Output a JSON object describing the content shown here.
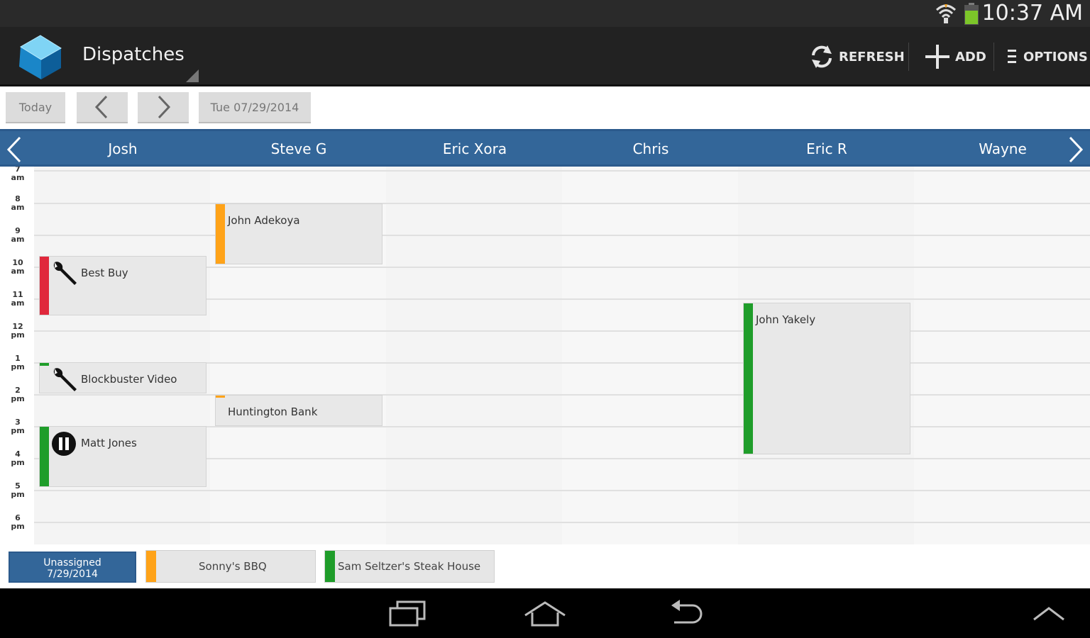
{
  "status_bar": {
    "time": "10:37 AM"
  },
  "app": {
    "title": "Dispatches"
  },
  "actions": {
    "refresh": "REFRESH",
    "add": "ADD",
    "options": "OPTIONS"
  },
  "toolbar": {
    "today": "Today",
    "date": "Tue 07/29/2014"
  },
  "technicians": [
    "Josh",
    "Steve G",
    "Eric Xora",
    "Chris",
    "Eric R",
    "Wayne"
  ],
  "time_slots": [
    {
      "h": "7",
      "p": "am"
    },
    {
      "h": "8",
      "p": "am"
    },
    {
      "h": "9",
      "p": "am"
    },
    {
      "h": "10",
      "p": "am"
    },
    {
      "h": "11",
      "p": "am"
    },
    {
      "h": "12",
      "p": "pm"
    },
    {
      "h": "1",
      "p": "pm"
    },
    {
      "h": "2",
      "p": "pm"
    },
    {
      "h": "3",
      "p": "pm"
    },
    {
      "h": "4",
      "p": "pm"
    },
    {
      "h": "5",
      "p": "pm"
    },
    {
      "h": "6",
      "p": "pm"
    }
  ],
  "appointments": [
    {
      "name": "Best Buy",
      "tech": "Josh",
      "color": "#e0283c",
      "icon": "wrench-icon"
    },
    {
      "name": "Blockbuster Video",
      "tech": "Josh",
      "color": "#1f9d2a",
      "icon": "wrench-icon"
    },
    {
      "name": "Matt Jones",
      "tech": "Josh",
      "color": "#1f9d2a",
      "icon": "pause-icon"
    },
    {
      "name": "John Adekoya",
      "tech": "Steve G",
      "color": "#ffa319",
      "icon": ""
    },
    {
      "name": "Huntington Bank",
      "tech": "Steve G",
      "color": "#ffa319",
      "icon": ""
    },
    {
      "name": "John Yakely",
      "tech": "Eric R",
      "color": "#1f9d2a",
      "icon": ""
    }
  ],
  "legend": {
    "unassigned_line1": "Unassigned",
    "unassigned_line2": "7/29/2014",
    "items": [
      {
        "name": "Sonny's BBQ",
        "color": "#ffa319"
      },
      {
        "name": "Sam Seltzer's Steak House",
        "color": "#1f9d2a"
      }
    ]
  },
  "colors": {
    "header": "#336699",
    "actionbar": "#222222",
    "red": "#e0283c",
    "green": "#1f9d2a",
    "orange": "#ffa319"
  }
}
